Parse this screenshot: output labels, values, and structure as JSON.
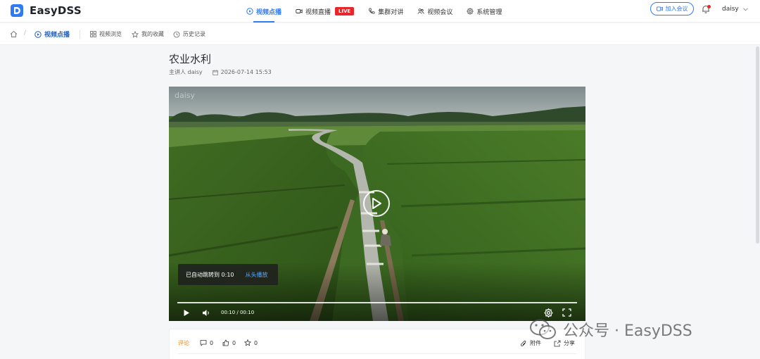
{
  "app": {
    "name": "EasyDSS"
  },
  "nav": {
    "items": [
      {
        "label": "视频点播",
        "icon": "play-circle-icon",
        "active": true
      },
      {
        "label": "视频直播",
        "icon": "video-camera-icon",
        "badge": "LIVE"
      },
      {
        "label": "集群对讲",
        "icon": "phone-icon"
      },
      {
        "label": "视频会议",
        "icon": "people-icon"
      },
      {
        "label": "系统管理",
        "icon": "gear-icon"
      }
    ]
  },
  "header": {
    "join_label": "加入会议",
    "user_name": "daisy"
  },
  "subnav": {
    "current": "视频点播",
    "items": [
      {
        "label": "视频浏览",
        "icon": "grid-icon"
      },
      {
        "label": "我的收藏",
        "icon": "star-icon"
      },
      {
        "label": "历史记录",
        "icon": "clock-icon"
      }
    ]
  },
  "video": {
    "title": "农业水利",
    "presenter": "主讲人 daisy",
    "datetime": "2026-07-14 15:53",
    "watermark": "daisy",
    "toast_text": "已自动跳转到 0:10",
    "toast_action": "从头播放",
    "time_display": "00:10 / 00:10",
    "progress": 1.0
  },
  "comments": {
    "tab_label": "评论",
    "comment_count": "0",
    "like_count": "0",
    "favorite_count": "0",
    "attachment_label": "附件",
    "share_label": "分享"
  },
  "overlay": {
    "wechat_watermark": "公众号 · EasyDSS"
  },
  "colors": {
    "accent": "#2f7bf5",
    "live": "#e8262b",
    "comment_tab": "#f08a1a"
  }
}
